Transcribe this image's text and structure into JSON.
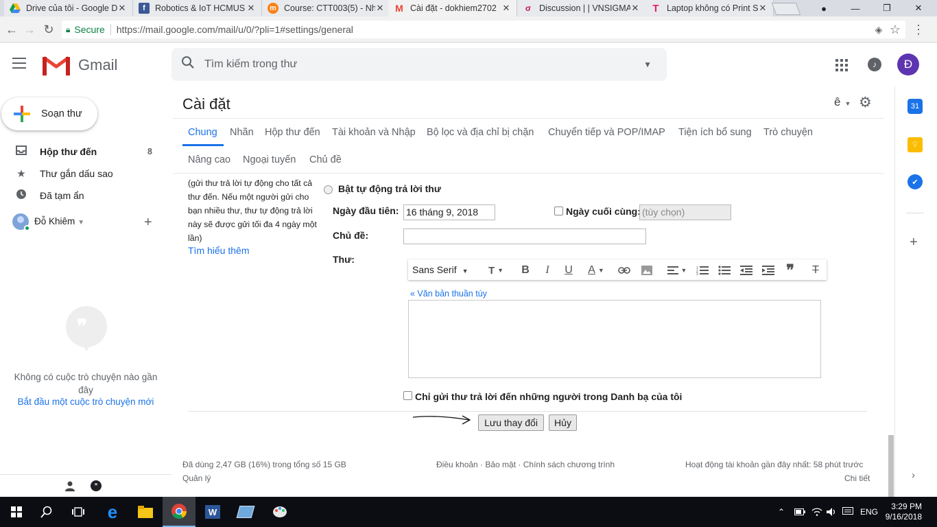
{
  "browser": {
    "tabs": [
      {
        "title": "Drive của tôi - Google D",
        "favicon": "drive-icon",
        "active": false
      },
      {
        "title": "Robotics & IoT HCMUS",
        "favicon": "facebook-icon",
        "active": false
      },
      {
        "title": "Course: CTT003(5) - Nh",
        "favicon": "moodle-icon",
        "active": false
      },
      {
        "title": "Cài đặt - dokhiem2702",
        "favicon": "gmail-icon",
        "active": true
      },
      {
        "title": "Discussion | | VNSIGMA",
        "favicon": "vnsigma-icon",
        "active": false
      },
      {
        "title": "Laptop không có Print S",
        "favicon": "t-icon",
        "active": false
      }
    ],
    "secure_label": "Secure",
    "url": "https://mail.google.com/mail/u/0/?pli=1#settings/general"
  },
  "header": {
    "app_name": "Gmail",
    "search_placeholder": "Tìm kiếm trong thư",
    "avatar_letter": "Đ"
  },
  "sidebar": {
    "compose_label": "Soạn thư",
    "items": [
      {
        "label": "Hộp thư đến",
        "count": "8",
        "icon": "inbox-icon",
        "bold": true
      },
      {
        "label": "Thư gắn dấu sao",
        "count": "",
        "icon": "star-icon",
        "bold": false
      },
      {
        "label": "Đã tạm ẩn",
        "count": "",
        "icon": "clock-icon",
        "bold": false
      }
    ],
    "user_name": "Đỗ Khiêm",
    "no_chat_text_1": "Không có cuộc trò chuyện nào gần",
    "no_chat_text_2": "đây",
    "start_chat_link": "Bắt đầu một cuộc trò chuyện mới"
  },
  "settings": {
    "title": "Cài đặt",
    "lang_char": "ê",
    "tabs_row1": [
      "Chung",
      "Nhãn",
      "Hộp thư đến",
      "Tài khoản và Nhập",
      "Bộ lọc và địa chỉ bị chặn",
      "Chuyển tiếp và POP/IMAP",
      "Tiện ích bổ sung",
      "Trò chuyện"
    ],
    "tabs_row2": [
      "Nâng cao",
      "Ngoại tuyến",
      "Chủ đề"
    ],
    "help_text": [
      "(gửi thư trả lời tự động cho tất cả",
      "thư đến. Nếu một người gửi cho",
      "bạn nhiều thư, thư tự động trả lời",
      "này sẽ được gửi tối đa 4 ngày một",
      "lần)"
    ],
    "learn_more": "Tìm hiểu thêm",
    "auto_reply_on": "Bật tự động trả lời thư",
    "first_day_label": "Ngày đầu tiên:",
    "first_day_value": "16 tháng 9, 2018",
    "last_day_label": "Ngày cuối cùng:",
    "last_day_placeholder": "(tùy chọn)",
    "subject_label": "Chủ đề:",
    "message_label": "Thư:",
    "font_name": "Sans Serif",
    "plain_text_link": "« Văn bản thuần túy",
    "contacts_only": "Chỉ gửi thư trả lời đến những người trong Danh bạ của tôi",
    "save_button": "Lưu thay đổi",
    "cancel_button": "Hủy"
  },
  "footer": {
    "storage": "Đã dùng 2,47 GB (16%) trong tổng số 15 GB",
    "manage": "Quản lý",
    "links": "Điều khoản · Bảo mật · Chính sách chương trình",
    "activity": "Hoạt động tài khoản gần đây nhất: 58 phút trước",
    "details": "Chi tiết"
  },
  "taskbar": {
    "time": "3:29 PM",
    "date": "9/16/2018",
    "lang": "ENG"
  },
  "colors": {
    "accent": "#1a73e8",
    "gmail_red": "#ea4335",
    "avatar_bg": "#5e35b1"
  }
}
